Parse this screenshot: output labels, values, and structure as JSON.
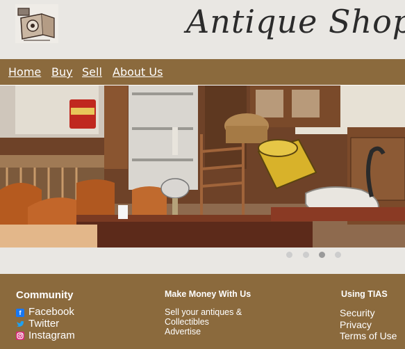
{
  "site": {
    "title": "Antique Shop"
  },
  "nav": {
    "items": [
      "Home",
      "Buy",
      "Sell",
      "About Us"
    ]
  },
  "hero": {
    "slides": 4,
    "active_slide": 3
  },
  "footer": {
    "community": {
      "title": "Community",
      "links": [
        "Facebook",
        "Twitter",
        "Instagram"
      ]
    },
    "money": {
      "title": "Make Money With Us",
      "line1": "Sell your antiques &",
      "line2": "Collectibles",
      "line3": "Advertise"
    },
    "tias": {
      "title": "Using TIAS",
      "links": [
        "Security",
        "Privacy",
        "Terms of Use"
      ]
    }
  },
  "colors": {
    "nav": "#8b6a3d",
    "header": "#e9e7e3",
    "footer": "#8b6a3d",
    "facebook": "#1877f2",
    "twitter": "#1da1f2",
    "instagram": "#d62976"
  },
  "icons": [
    "camera-logo-icon",
    "facebook-icon",
    "twitter-icon",
    "instagram-icon"
  ]
}
